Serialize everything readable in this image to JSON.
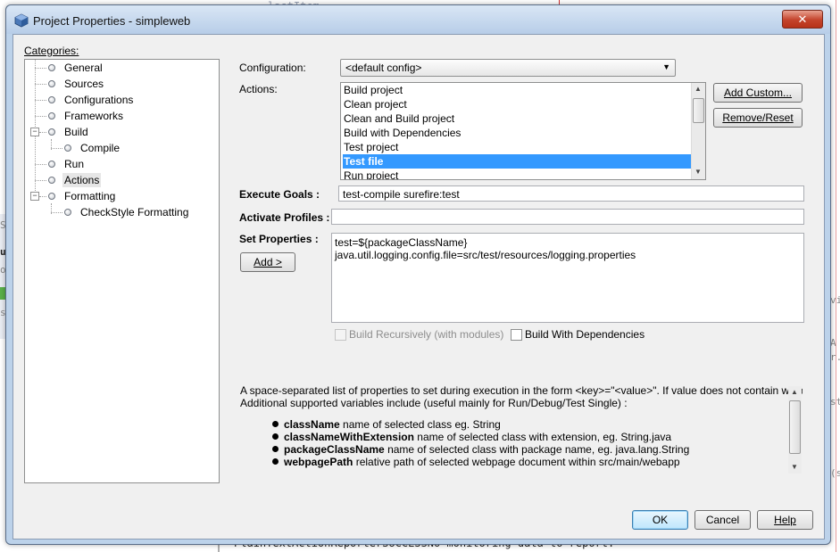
{
  "background": {
    "top_code": "lastItem",
    "bottom_code": "PlainTextActionReporterSUCCESSNo monitoring data to report.",
    "right_glyphs": [
      "vi",
      "A",
      "r.",
      "st",
      "(s"
    ],
    "left_glyphs": [
      "ST",
      "u",
      "oa",
      "st"
    ]
  },
  "window": {
    "title": "Project Properties - simpleweb",
    "close_glyph": "✕"
  },
  "categories": {
    "label": "Categories:",
    "items": [
      {
        "label": "General"
      },
      {
        "label": "Sources"
      },
      {
        "label": "Configurations"
      },
      {
        "label": "Frameworks"
      },
      {
        "label": "Build"
      },
      {
        "label": "Compile"
      },
      {
        "label": "Run"
      },
      {
        "label": "Actions"
      },
      {
        "label": "Formatting"
      },
      {
        "label": "CheckStyle Formatting"
      }
    ],
    "selected": "Actions"
  },
  "configuration": {
    "label": "Configuration:",
    "value": "<default config>"
  },
  "actions": {
    "label": "Actions:",
    "items": [
      "Build project",
      "Clean project",
      "Clean and Build project",
      "Build with Dependencies",
      "Test project",
      "Test file",
      "Run project"
    ],
    "selected": "Test file",
    "add_custom": "Add Custom...",
    "remove_reset": "Remove/Reset"
  },
  "execute_goals": {
    "label": "Execute Goals :",
    "value": "test-compile surefire:test"
  },
  "activate_profiles": {
    "label": "Activate Profiles :",
    "value": ""
  },
  "set_properties": {
    "label": "Set Properties :",
    "add_button": "Add >",
    "value": "test=${packageClassName}\njava.util.logging.config.file=src/test/resources/logging.properties"
  },
  "options": {
    "build_recursively": "Build Recursively (with modules)",
    "build_with_dependencies": "Build With Dependencies"
  },
  "help": {
    "line1": "A space-separated list of properties to set during execution in the form <key>=\"<value>\". If value does not contain whitespac",
    "line2": "Additional supported variables include (useful mainly for Run/Debug/Test Single) :",
    "bullets": [
      {
        "term": "className",
        "desc": " name of selected class eg. String"
      },
      {
        "term": "classNameWithExtension",
        "desc": " name of selected class with extension, eg. String.java"
      },
      {
        "term": "packageClassName",
        "desc": " name of selected class with package name, eg. java.lang.String"
      },
      {
        "term": "webpagePath",
        "desc": " relative path of selected webpage document within src/main/webapp"
      }
    ]
  },
  "footer": {
    "ok": "OK",
    "cancel": "Cancel",
    "help": "Help"
  }
}
